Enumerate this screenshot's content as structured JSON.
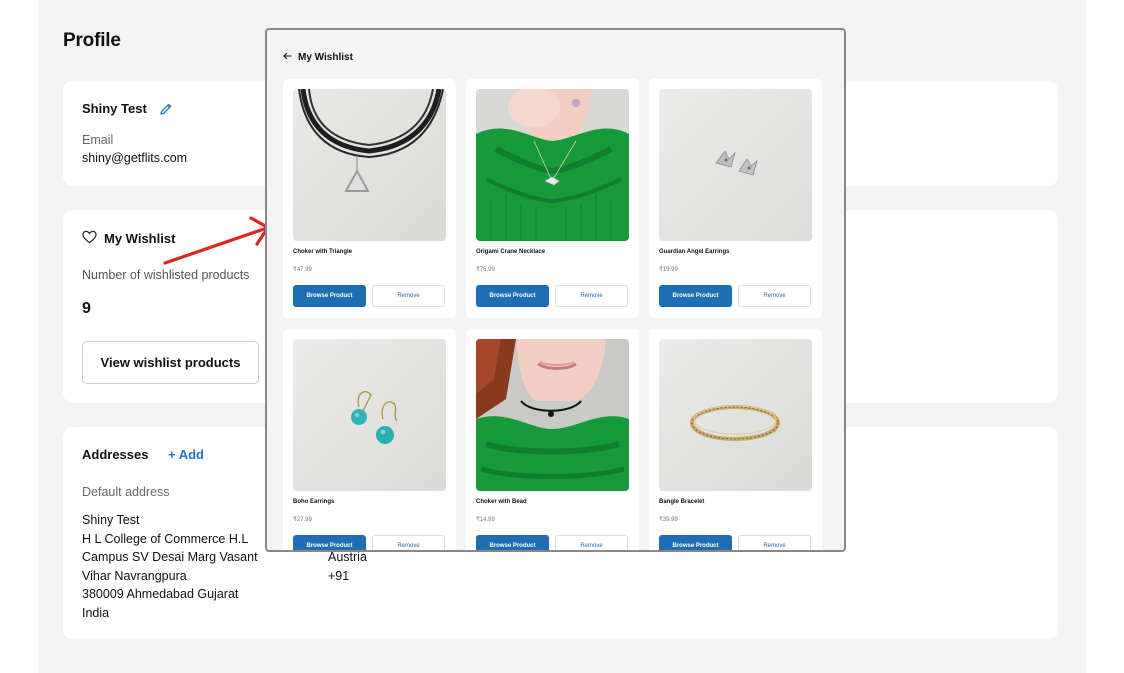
{
  "profile": {
    "title": "Profile",
    "name": "Shiny Test",
    "email_label": "Email",
    "email": "shiny@getflits.com"
  },
  "wishlist_card": {
    "heading": "My Wishlist",
    "count_label": "Number of wishlisted products",
    "count": "9",
    "view_button": "View wishlist products"
  },
  "addresses": {
    "heading": "Addresses",
    "add_label": "+ Add",
    "default_label": "Default address",
    "left_lines": [
      "Shiny Test",
      "H L College of Commerce H.L",
      "Campus SV Desai Marg Vasant",
      "Vihar Navrangpura",
      "380009 Ahmedabad Gujarat",
      "India"
    ],
    "right_lines": [
      "Austria",
      "+91"
    ]
  },
  "modal": {
    "back_icon": "arrow-left-icon",
    "title": "My Wishlist",
    "browse_label": "Browse Product",
    "remove_label": "Remove",
    "products": [
      {
        "name": "Choker with Triangle",
        "price": "₹47.99"
      },
      {
        "name": "Origami Crane Necklace",
        "price": "₹75.99"
      },
      {
        "name": "Guardian Angel Earrings",
        "price": "₹19.99"
      },
      {
        "name": "Boho Earrings",
        "price": "₹27.99"
      },
      {
        "name": "Choker with Bead",
        "price": "₹14.99"
      },
      {
        "name": "Bangle Bracelet",
        "price": "₹39.99"
      }
    ]
  },
  "colors": {
    "accent": "#1f6db3",
    "annotation_arrow": "#e02424",
    "page_bg": "#f3f3f3"
  }
}
